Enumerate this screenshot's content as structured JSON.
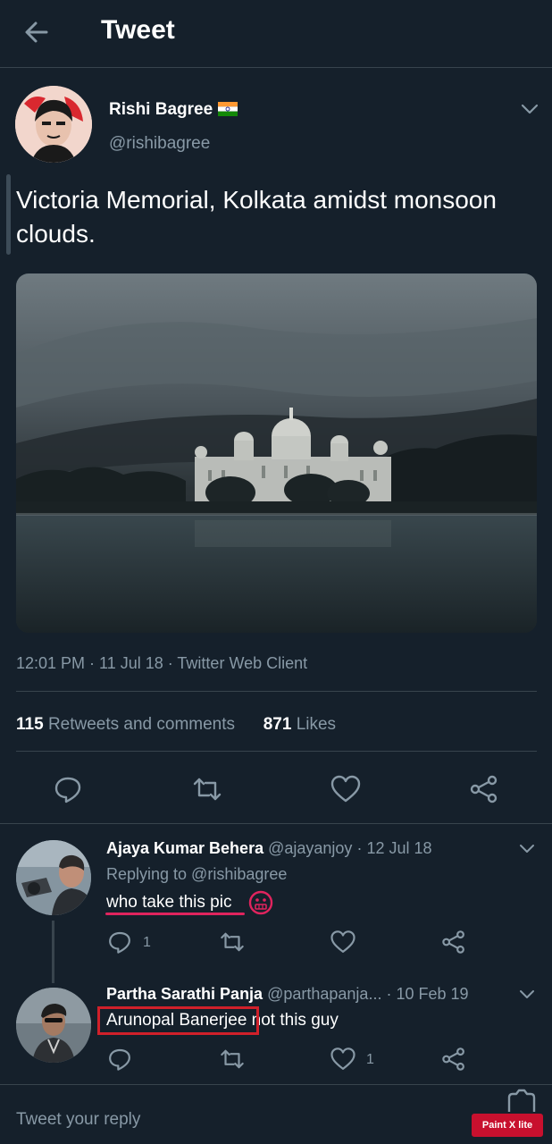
{
  "header": {
    "title": "Tweet",
    "back_icon": "arrow-left-icon"
  },
  "tweet": {
    "author_name": "Rishi Bagree",
    "author_handle": "@rishibagree",
    "flag_icon": "india-flag-icon",
    "text": "Victoria Memorial, Kolkata amidst monsoon clouds.",
    "timestamp": "12:01 PM · 11 Jul 18 · Twitter Web Client",
    "retweets_count": "115",
    "retweets_label": "Retweets and comments",
    "likes_count": "871",
    "likes_label": "Likes"
  },
  "replies": [
    {
      "name": "Ajaya Kumar Behera",
      "handle": "@ajayanjoy",
      "date": "· 12 Jul 18",
      "replying_to": "Replying to @rishibagree",
      "text": "who take this pic",
      "emoji": "grimacing-face-emoji",
      "reply_count": "1",
      "like_count": ""
    },
    {
      "name": "Partha Sarathi Panja",
      "handle": "@parthapanja...",
      "date": "· 10 Feb 19",
      "text_highlight": "Arunopal Banerjee",
      "text_rest": " not this guy",
      "reply_count": "",
      "like_count": "1"
    }
  ],
  "reply_bar": {
    "placeholder": "Tweet your reply"
  },
  "watermark": {
    "label": "Paint X lite"
  },
  "colors": {
    "background": "#15202b",
    "secondary_text": "#8899a6",
    "divider": "#38444d",
    "annotation_red": "#d0202a"
  }
}
